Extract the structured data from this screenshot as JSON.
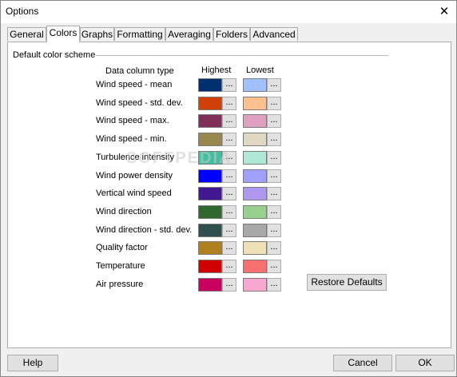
{
  "window": {
    "title": "Options"
  },
  "tabs": [
    {
      "label": "General"
    },
    {
      "label": "Colors"
    },
    {
      "label": "Graphs"
    },
    {
      "label": "Formatting"
    },
    {
      "label": "Averaging"
    },
    {
      "label": "Folders"
    },
    {
      "label": "Advanced"
    }
  ],
  "active_tab": "Colors",
  "group": {
    "title": "Default color scheme"
  },
  "columns": {
    "type": "Data column type",
    "highest": "Highest",
    "lowest": "Lowest",
    "picker_label": "..."
  },
  "rows": [
    {
      "label": "Wind speed - mean",
      "highest": "#003070",
      "lowest": "#a0c0ff"
    },
    {
      "label": "Wind speed - std. dev.",
      "highest": "#d04008",
      "lowest": "#ffc090"
    },
    {
      "label": "Wind speed - max.",
      "highest": "#803058",
      "lowest": "#e0a0c0"
    },
    {
      "label": "Wind speed - min.",
      "highest": "#988850",
      "lowest": "#e0d8c0"
    },
    {
      "label": "Turbulence intensity",
      "highest": "#40c0a0",
      "lowest": "#b0e8d8"
    },
    {
      "label": "Wind power density",
      "highest": "#0000ff",
      "lowest": "#a0a0ff"
    },
    {
      "label": "Vertical wind speed",
      "highest": "#401890",
      "lowest": "#b098f0"
    },
    {
      "label": "Wind direction",
      "highest": "#306830",
      "lowest": "#98d090"
    },
    {
      "label": "Wind direction - std. dev.",
      "highest": "#305050",
      "lowest": "#a8a8a8"
    },
    {
      "label": "Quality factor",
      "highest": "#b08020",
      "lowest": "#f0e0b8"
    },
    {
      "label": "Temperature",
      "highest": "#d00000",
      "lowest": "#f87070"
    },
    {
      "label": "Air pressure",
      "highest": "#c80060",
      "lowest": "#f8a8d0"
    }
  ],
  "buttons": {
    "restore": "Restore Defaults",
    "help": "Help",
    "cancel": "Cancel",
    "ok": "OK"
  },
  "watermark": "SOFTPEDIA"
}
